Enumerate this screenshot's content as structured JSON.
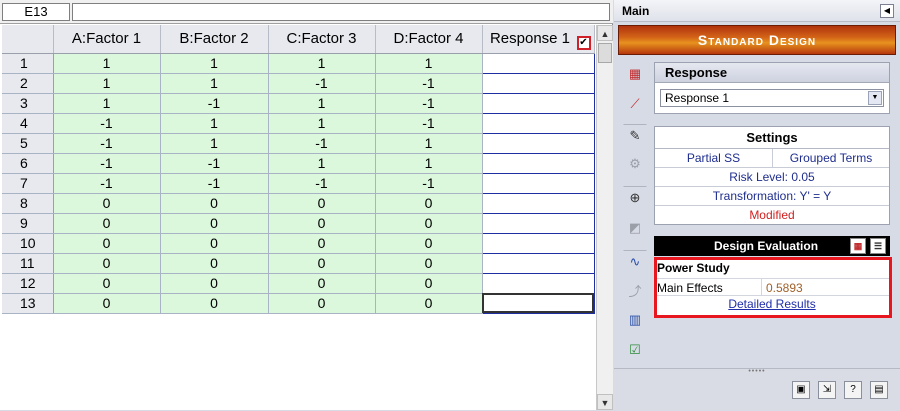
{
  "formula_bar": {
    "cell_ref": "E13",
    "content": ""
  },
  "sheet": {
    "columns": [
      "A:Factor 1",
      "B:Factor 2",
      "C:Factor 3",
      "D:Factor 4",
      "Response 1"
    ],
    "rows": [
      {
        "n": "1",
        "v": [
          "1",
          "1",
          "1",
          "1"
        ]
      },
      {
        "n": "2",
        "v": [
          "1",
          "1",
          "-1",
          "-1"
        ]
      },
      {
        "n": "3",
        "v": [
          "1",
          "-1",
          "1",
          "-1"
        ]
      },
      {
        "n": "4",
        "v": [
          "-1",
          "1",
          "1",
          "-1"
        ]
      },
      {
        "n": "5",
        "v": [
          "-1",
          "1",
          "-1",
          "1"
        ]
      },
      {
        "n": "6",
        "v": [
          "-1",
          "-1",
          "1",
          "1"
        ]
      },
      {
        "n": "7",
        "v": [
          "-1",
          "-1",
          "-1",
          "-1"
        ]
      },
      {
        "n": "8",
        "v": [
          "0",
          "0",
          "0",
          "0"
        ]
      },
      {
        "n": "9",
        "v": [
          "0",
          "0",
          "0",
          "0"
        ]
      },
      {
        "n": "10",
        "v": [
          "0",
          "0",
          "0",
          "0"
        ]
      },
      {
        "n": "11",
        "v": [
          "0",
          "0",
          "0",
          "0"
        ]
      },
      {
        "n": "12",
        "v": [
          "0",
          "0",
          "0",
          "0"
        ]
      },
      {
        "n": "13",
        "v": [
          "0",
          "0",
          "0",
          "0"
        ]
      }
    ]
  },
  "panel": {
    "title": "Main",
    "banner": "Standard Design",
    "response": {
      "heading": "Response",
      "selected": "Response 1"
    },
    "settings": {
      "heading": "Settings",
      "ss": "Partial SS",
      "terms": "Grouped Terms",
      "risk": "Risk Level: 0.05",
      "transformation": "Transformation: Y' = Y",
      "status": "Modified"
    },
    "evaluation": {
      "heading": "Design Evaluation",
      "power_title": "Power Study",
      "main_label": "Main Effects",
      "main_value": "0.5893",
      "link": "Detailed Results"
    }
  },
  "colors": {
    "factor_bg": "#dcf8dc",
    "banner": "#d36318",
    "highlight": "#e8161e",
    "link": "#1f2ea8"
  }
}
